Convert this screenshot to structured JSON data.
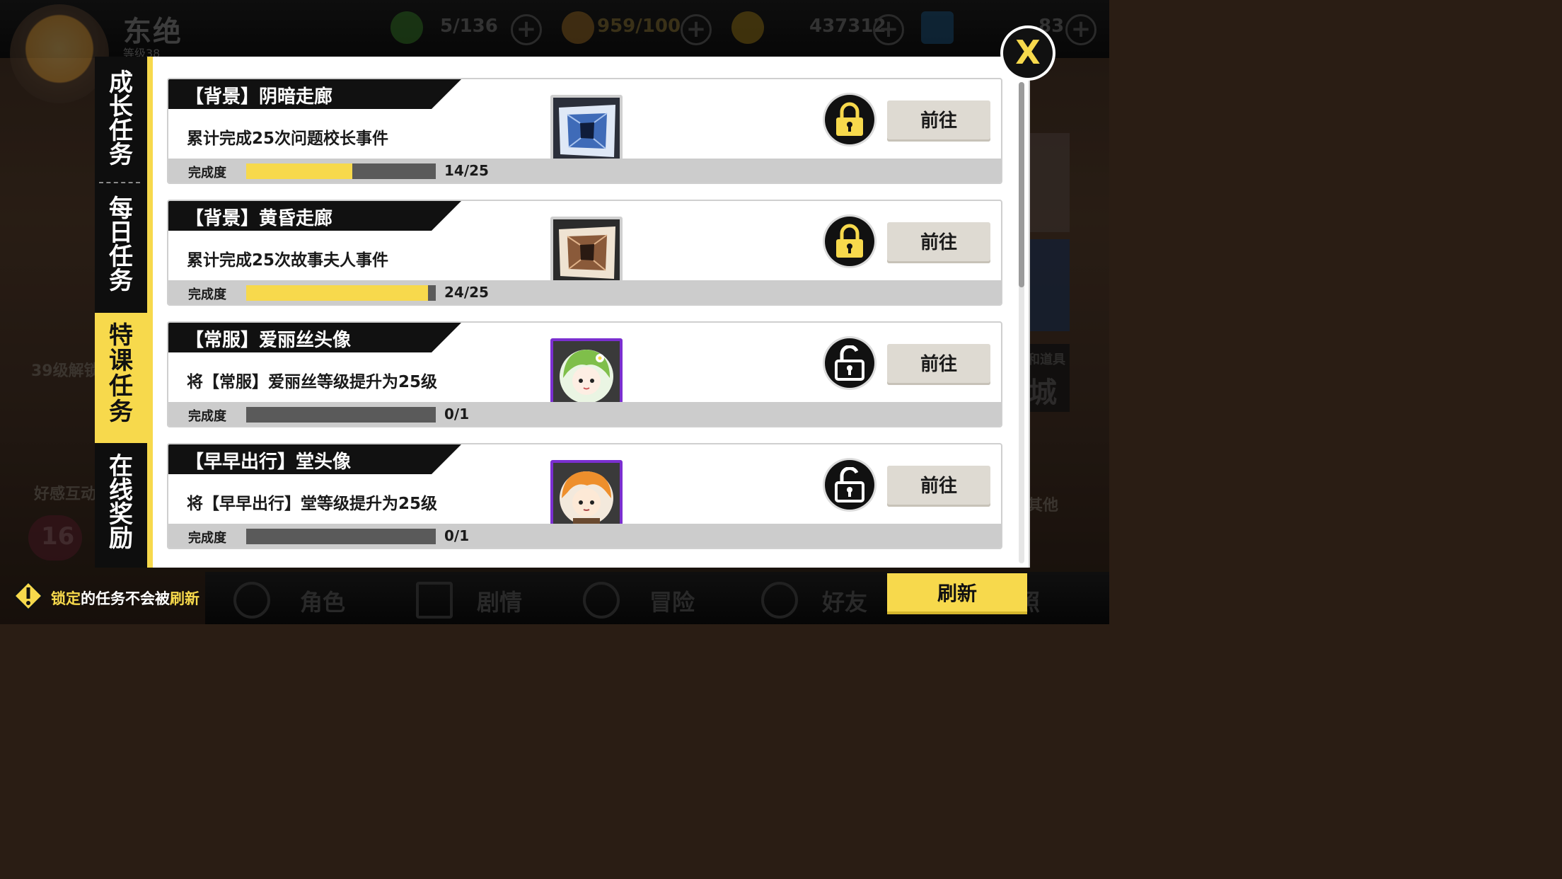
{
  "app": {
    "player": {
      "name": "东绝",
      "level": "等级38"
    },
    "resources": [
      {
        "icon": "energy-icon",
        "value": "5/136"
      },
      {
        "icon": "battery-icon",
        "value": "959/100"
      },
      {
        "icon": "coin-icon",
        "value": "437312"
      },
      {
        "icon": "cube-gem-icon",
        "value": "83"
      }
    ],
    "background_labels": {
      "unlock_39": "39级解锁",
      "affection": "好感互动",
      "other": "其他",
      "shop_small": "和道具",
      "shop_big": "城",
      "badge_count": "16"
    },
    "bottom_nav": [
      "角色",
      "剧情",
      "冒险",
      "好友",
      "照"
    ]
  },
  "modal": {
    "tabs": [
      {
        "label": "成长任务",
        "active": false
      },
      {
        "label": "每日任务",
        "active": false
      },
      {
        "label": "特课任务",
        "active": true
      },
      {
        "label": "在线奖励",
        "active": false
      }
    ],
    "close_label": "X",
    "tasks": [
      {
        "title": "【背景】阴暗走廊",
        "description": "累计完成25次问题校长事件",
        "progress_label": "完成度",
        "progress_text": "14/25",
        "progress_fraction": 0.56,
        "thumbnail": "blue-corridor-thumbnail",
        "lock_state": "locked",
        "button_label": "前往"
      },
      {
        "title": "【背景】黄昏走廊",
        "description": "累计完成25次故事夫人事件",
        "progress_label": "完成度",
        "progress_text": "24/25",
        "progress_fraction": 0.96,
        "thumbnail": "sunset-corridor-thumbnail",
        "lock_state": "locked",
        "button_label": "前往"
      },
      {
        "title": "【常服】爱丽丝头像",
        "description": "将【常服】爱丽丝等级提升为25级",
        "progress_label": "完成度",
        "progress_text": "0/1",
        "progress_fraction": 0.0,
        "thumbnail": "alice-avatar-thumbnail",
        "lock_state": "unlocked",
        "button_label": "前往"
      },
      {
        "title": "【早早出行】堂头像",
        "description": "将【早早出行】堂等级提升为25级",
        "progress_label": "完成度",
        "progress_text": "0/1",
        "progress_fraction": 0.0,
        "thumbnail": "tang-avatar-thumbnail",
        "lock_state": "unlocked",
        "button_label": "前往"
      }
    ]
  },
  "tip": {
    "highlight_1": "锁定",
    "middle": "的任务不会被",
    "highlight_2": "刷新"
  },
  "refresh_label": "刷新",
  "colors": {
    "accent_yellow": "#f7d94c",
    "panel_black": "#111111",
    "progress_track": "#5a5a5a",
    "avatar_frame_purple": "#7b2fd0",
    "button_beige": "#dedad2"
  }
}
